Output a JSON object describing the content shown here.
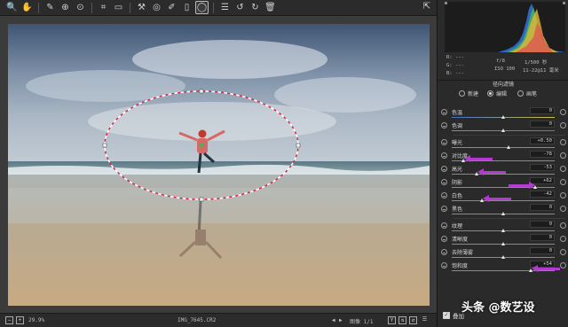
{
  "toolbar": {
    "icons": [
      "zoom-icon",
      "hand-icon",
      "white-balance-icon",
      "color-sampler-icon",
      "target-adjust-icon",
      "crop-icon",
      "straighten-icon",
      "spot-removal-icon",
      "red-eye-icon",
      "brush-icon",
      "graduated-filter-icon",
      "radial-filter-icon",
      "list-icon",
      "rotate-left-icon",
      "rotate-right-icon",
      "trash-icon"
    ],
    "glyphs": [
      "🔍",
      "✋",
      "✎",
      "⊕",
      "⊙",
      "⌗",
      "▭",
      "⚒",
      "◎",
      "✐",
      "▯",
      "◯",
      "☰",
      "↺",
      "↻",
      "🗑"
    ],
    "active_index": 11
  },
  "statusbar": {
    "zoom": "29.9%",
    "filename": "IMG_7645.CR2",
    "image_count": "图像 1/1"
  },
  "info": {
    "r_label": "R:",
    "g_label": "G:",
    "b_label": "B:",
    "r_value": "---",
    "g_value": "---",
    "b_value": "---",
    "aperture": "f/8",
    "shutter": "1/500 秒",
    "iso": "ISO 100",
    "lens": "11-22@11 毫米"
  },
  "panel": {
    "title": "径向滤镜",
    "modes": [
      "新建",
      "编辑",
      "画笔"
    ],
    "selected_mode": 1
  },
  "sliders": [
    {
      "label": "色温",
      "value": "0",
      "pos": 0.5,
      "group": 1
    },
    {
      "label": "色调",
      "value": "0",
      "pos": 0.5,
      "group": 1
    },
    {
      "label": "曝光",
      "value": "+0.50",
      "pos": 0.55,
      "group": 2
    },
    {
      "label": "对比度",
      "value": "-78",
      "pos": 0.11,
      "group": 2,
      "arrow": "left"
    },
    {
      "label": "高光",
      "value": "-53",
      "pos": 0.24,
      "group": 2,
      "arrow": "left"
    },
    {
      "label": "阴影",
      "value": "+62",
      "pos": 0.81,
      "group": 2,
      "arrow": "right"
    },
    {
      "label": "白色",
      "value": "-42",
      "pos": 0.29,
      "group": 2,
      "arrow": "left"
    },
    {
      "label": "黑色",
      "value": "0",
      "pos": 0.5,
      "group": 2
    },
    {
      "label": "纹理",
      "value": "0",
      "pos": 0.5,
      "group": 3
    },
    {
      "label": "清晰度",
      "value": "0",
      "pos": 0.5,
      "group": 3
    },
    {
      "label": "去除薄雾",
      "value": "0",
      "pos": 0.5,
      "group": 3
    },
    {
      "label": "饱和度",
      "value": "+54",
      "pos": 0.77,
      "group": 3,
      "arrow": "left"
    }
  ],
  "overlay_label": "叠加",
  "watermark": "头条 @数艺设",
  "colors": {
    "accent_arrow": "#b33ad1",
    "panel_bg": "#2a2a2a"
  }
}
